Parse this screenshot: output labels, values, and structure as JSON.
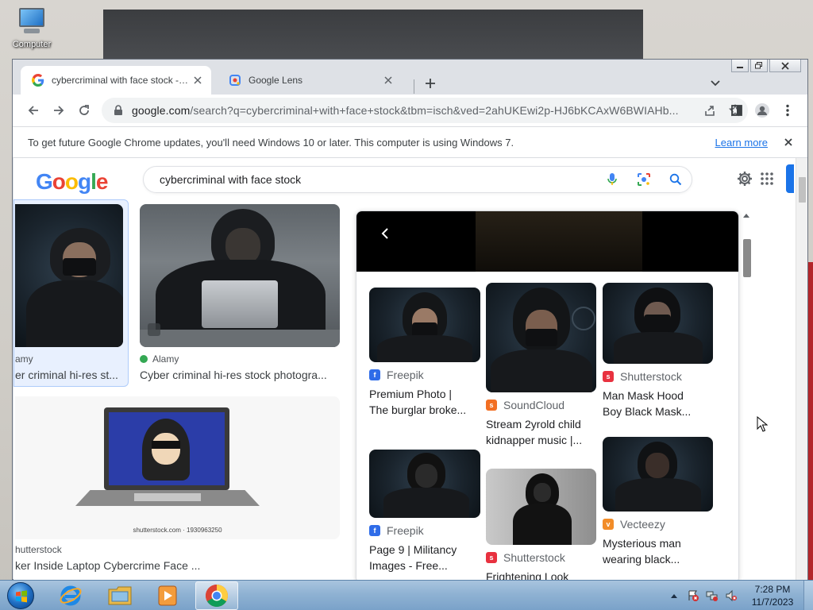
{
  "desktop": {
    "icon_label": "Computer"
  },
  "window": {
    "tabs": [
      {
        "title": "cybercriminal with face stock - Google Search",
        "favicon": "google-g-icon"
      },
      {
        "title": "Google Lens",
        "favicon": "google-lens-icon"
      }
    ],
    "address": {
      "host": "google.com",
      "path": "/search?q=cybercriminal+with+face+stock&tbm=isch&ved=2ahUKEwi2p-HJ6bKCAxW6BWIAHb..."
    },
    "infobar": {
      "message": "To get future Google Chrome updates, you'll need Windows 10 or later. This computer is using Windows 7.",
      "link": "Learn more"
    }
  },
  "google": {
    "logo": [
      "G",
      "o",
      "o",
      "g",
      "l",
      "e"
    ],
    "query": "cybercriminal with face stock"
  },
  "results": [
    {
      "source": "amy",
      "title": "er criminal hi-res st..."
    },
    {
      "source": "Alamy",
      "title": "Cyber criminal hi-res stock photogra..."
    },
    {
      "source": "hutterstock",
      "title": "ker Inside Laptop Cybercrime Face ...",
      "caption": "shutterstock.com · 1930963250"
    }
  ],
  "related": [
    {
      "source": "Freepik",
      "title_1": "Premium Photo |",
      "title_2": "The burglar broke...",
      "logo_color": "#2f6ce8"
    },
    {
      "source": "SoundCloud",
      "title_1": "Stream 2yrold child",
      "title_2": "kidnapper music |...",
      "logo_color": "#f26f23"
    },
    {
      "source": "Shutterstock",
      "title_1": "Man Mask Hood",
      "title_2": "Boy Black Mask...",
      "logo_color": "#e8313f"
    },
    {
      "source": "Freepik",
      "title_1": "Page 9 | Militancy",
      "title_2": "Images - Free...",
      "logo_color": "#2f6ce8"
    },
    {
      "source": "Shutterstock",
      "title_1": "Frightening Look",
      "title_2": "",
      "logo_color": "#e8313f"
    },
    {
      "source": "Vecteezy",
      "title_1": "Mysterious man",
      "title_2": "wearing black...",
      "logo_color": "#f28c28"
    }
  ],
  "taskbar": {
    "time": "7:28 PM",
    "date": "11/7/2023"
  }
}
